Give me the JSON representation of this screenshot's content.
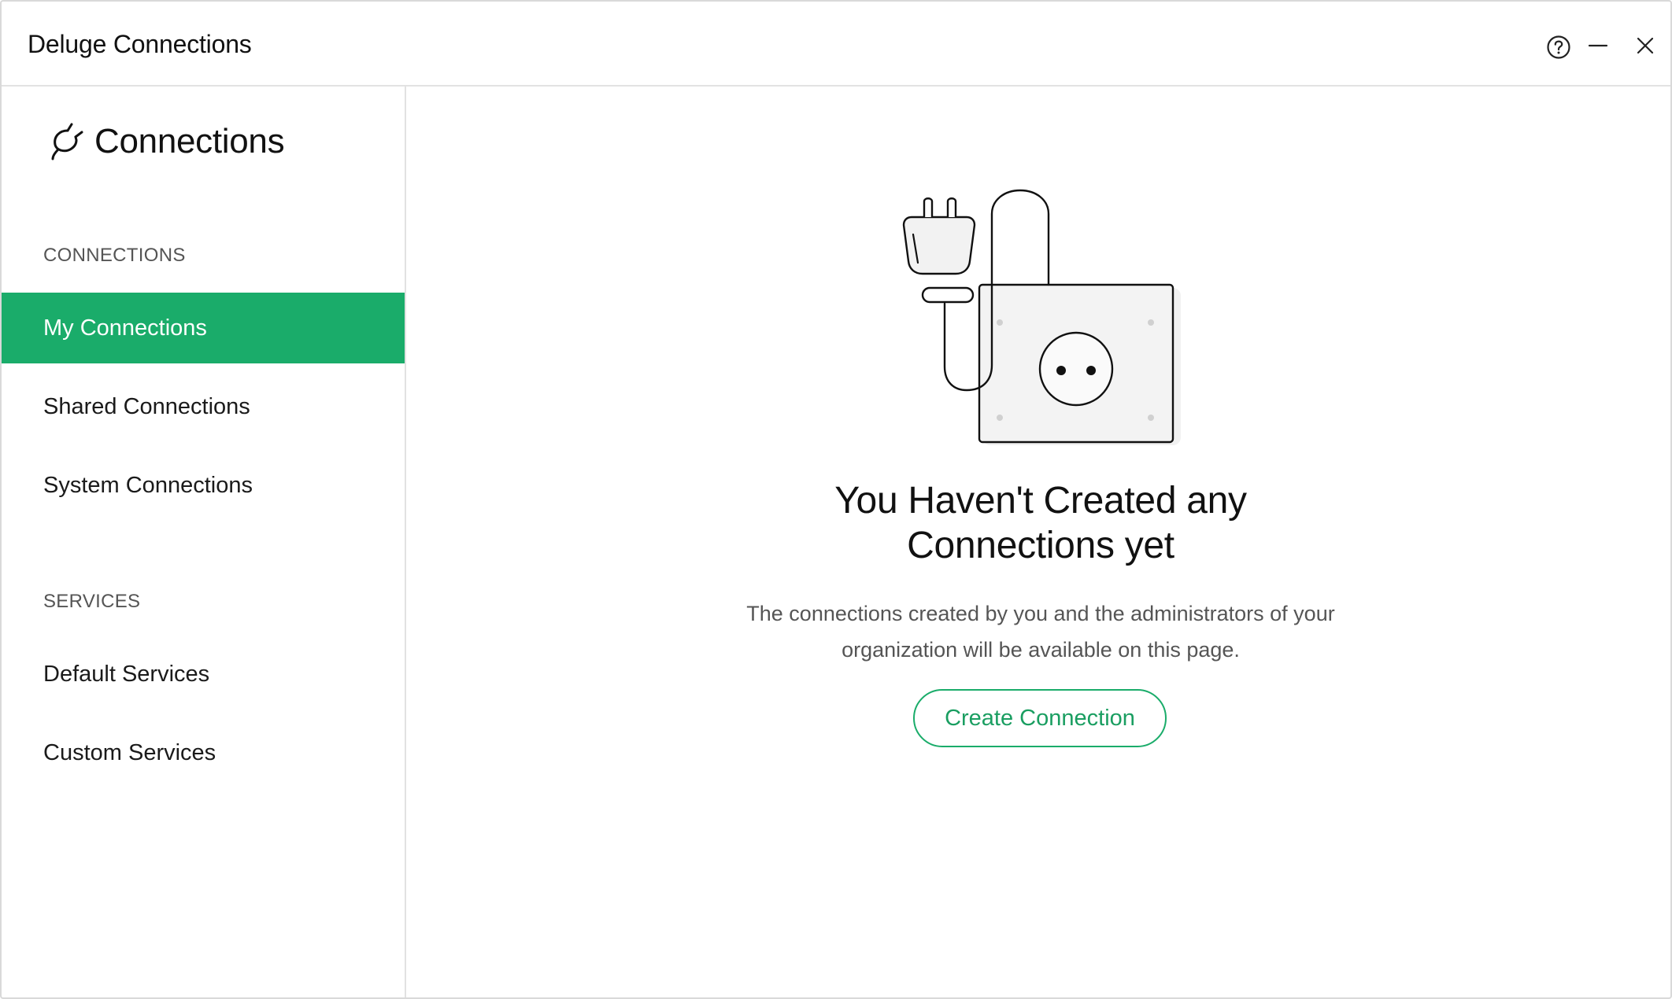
{
  "window": {
    "title": "Deluge Connections"
  },
  "header_controls": {
    "help_icon": "question-circle-icon",
    "minimize_icon": "minus-icon",
    "close_icon": "close-icon"
  },
  "sidebar": {
    "brand_icon": "plug-icon",
    "brand_label": "Connections",
    "sections": [
      {
        "title": "CONNECTIONS",
        "items": [
          {
            "label": "My Connections",
            "active": true
          },
          {
            "label": "Shared Connections",
            "active": false
          },
          {
            "label": "System Connections",
            "active": false
          }
        ]
      },
      {
        "title": "SERVICES",
        "items": [
          {
            "label": "Default Services",
            "active": false
          },
          {
            "label": "Custom Services",
            "active": false
          }
        ]
      }
    ]
  },
  "empty_state": {
    "illustration": "plug-and-socket-illustration",
    "title_line1": "You Haven't Created any",
    "title_line2": "Connections yet",
    "description_line1": "The connections created by you and the administrators of your",
    "description_line2": "organization will be available on this page.",
    "button_label": "Create Connection"
  },
  "colors": {
    "accent": "#1aac6a",
    "accent_text": "#1a9e61",
    "border": "#e2e2e2",
    "text_primary": "#111111",
    "text_secondary": "#555555"
  }
}
